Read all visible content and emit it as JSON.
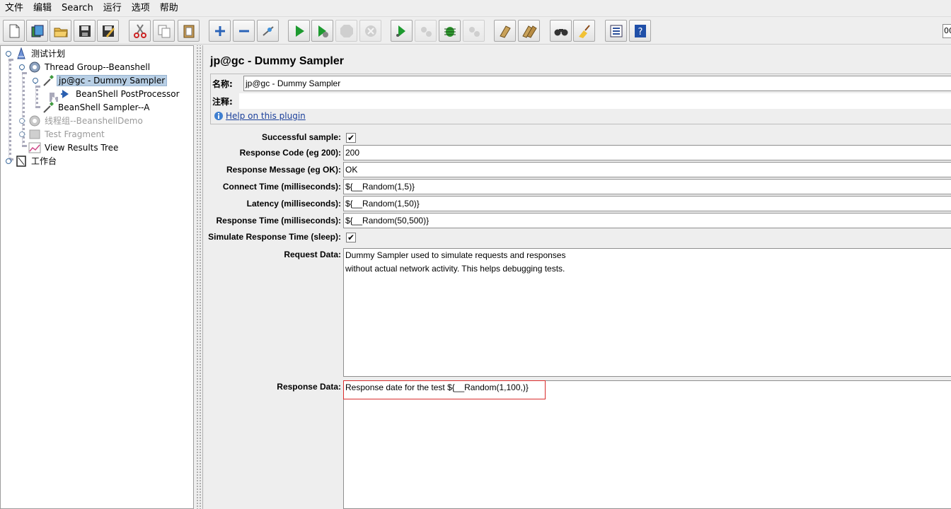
{
  "menu": [
    "文件",
    "编辑",
    "Search",
    "运行",
    "选项",
    "帮助"
  ],
  "toolbar": {
    "icons": [
      "new-icon",
      "templates-icon",
      "open-icon",
      "save-icon",
      "save-as-icon",
      "cut-icon",
      "copy-icon",
      "paste-icon",
      "expand-icon",
      "collapse-icon",
      "toggle-icon",
      "start-icon",
      "start-no-pause-icon",
      "stop-icon",
      "shutdown-icon",
      "remote-start-icon",
      "remote-stop-icon",
      "remote-start-all-icon",
      "remote-stop-all-icon",
      "clear-icon",
      "clear-all-icon",
      "search-icon",
      "reset-search-icon",
      "function-helper-icon",
      "help-icon"
    ],
    "right_partial": "00"
  },
  "tree": {
    "items": [
      {
        "label": "测试计划"
      },
      {
        "label": "Thread Group--Beanshell"
      },
      {
        "label": "jp@gc - Dummy Sampler"
      },
      {
        "label": "BeanShell PostProcessor"
      },
      {
        "label": "BeanShell Sampler--A"
      },
      {
        "label": "线程组--BeanshellDemo"
      },
      {
        "label": "Test Fragment"
      },
      {
        "label": "View Results Tree"
      },
      {
        "label": "工作台"
      }
    ]
  },
  "panel": {
    "title": "jp@gc - Dummy Sampler",
    "name_label": "名称:",
    "name_value": "jp@gc - Dummy Sampler",
    "comment_label": "注释:",
    "comment_value": "",
    "help_link": "Help on this plugin"
  },
  "fields": {
    "successful_label": "Successful sample:",
    "successful_checked": "✔",
    "response_code_label": "Response Code (eg 200):",
    "response_code_value": "200",
    "response_message_label": "Response Message (eg OK):",
    "response_message_value": "OK",
    "connect_time_label": "Connect Time (milliseconds):",
    "connect_time_value": "${__Random(1,5)}",
    "latency_label": "Latency (milliseconds):",
    "latency_value": "${__Random(1,50)}",
    "response_time_label": "Response Time (milliseconds):",
    "response_time_value": "${__Random(50,500)}",
    "simulate_label": "Simulate Response Time (sleep):",
    "simulate_checked": "✔",
    "request_data_label": "Request Data:",
    "request_data_line1": "Dummy Sampler used to simulate requests and responses",
    "request_data_line2": "without actual network activity. This helps debugging tests.",
    "response_data_label": "Response Data:",
    "response_data_value": "Response date for the test ${__Random(1,100,)}"
  }
}
